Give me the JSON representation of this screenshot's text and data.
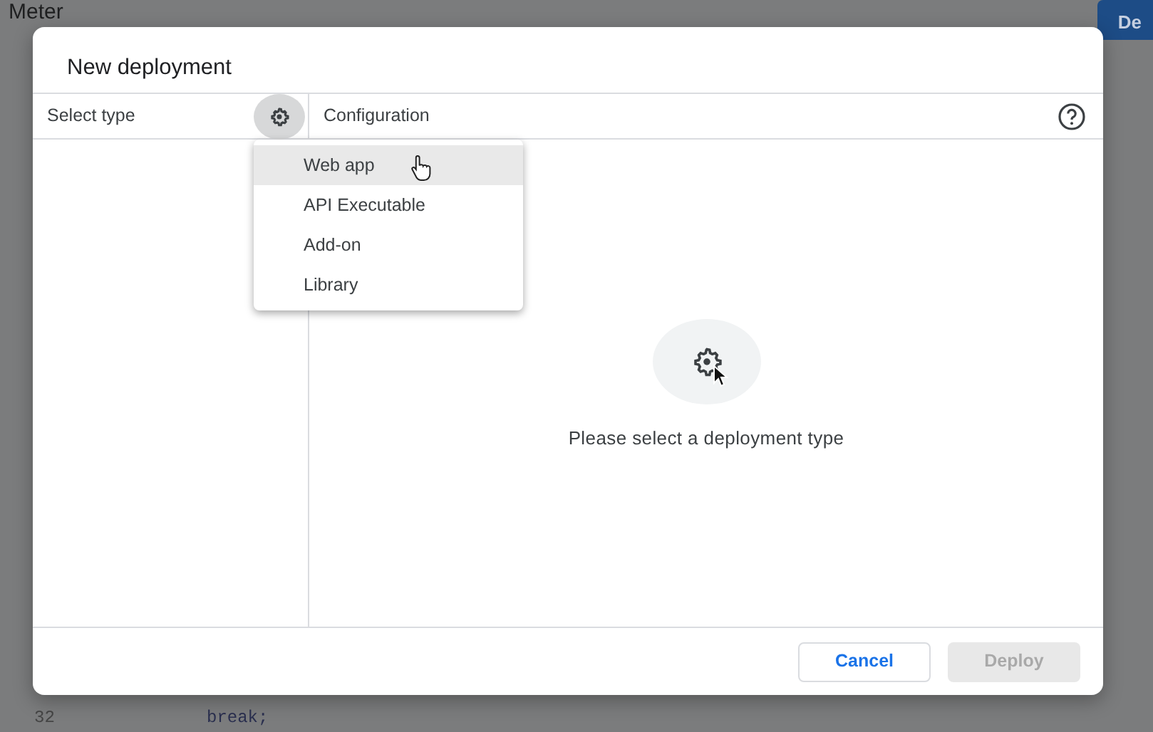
{
  "background": {
    "title": "Meter",
    "deploy_button": "De",
    "code_lines": [
      {
        "number": "32",
        "code": "break;"
      }
    ]
  },
  "dialog": {
    "title": "New deployment",
    "type_panel": {
      "label": "Select type"
    },
    "type_menu": {
      "expanded": true,
      "items": [
        {
          "label": "Web app",
          "selected": true
        },
        {
          "label": "API Executable",
          "selected": false
        },
        {
          "label": "Add-on",
          "selected": false
        },
        {
          "label": "Library",
          "selected": false
        }
      ]
    },
    "config_panel": {
      "label": "Configuration",
      "message": "Please select a deployment type"
    },
    "buttons": [
      {
        "label": "Cancel",
        "kind": "secondary",
        "disabled": false
      },
      {
        "label": "Deploy",
        "kind": "primary",
        "disabled": true
      }
    ]
  }
}
